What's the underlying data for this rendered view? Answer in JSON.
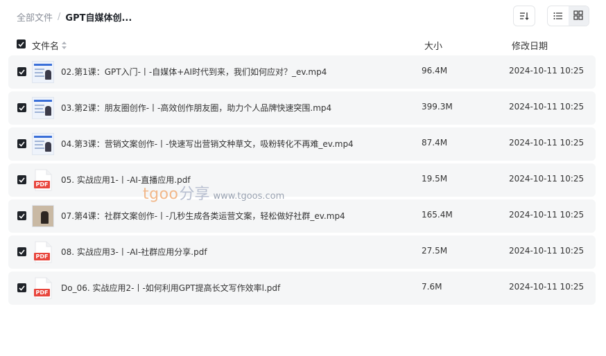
{
  "breadcrumb": {
    "root": "全部文件",
    "separator": "/",
    "current": "GPT自媒体创..."
  },
  "toolbar": {
    "sort_icon": "sort-icon",
    "list_view_icon": "list-view-icon",
    "grid_view_icon": "grid-view-icon",
    "active_view": "list"
  },
  "header": {
    "name": "文件名",
    "size": "大小",
    "date": "修改日期"
  },
  "files": [
    {
      "name": "02.第1课：GPT入门-丨-自媒体+AI时代到来，我们如何应对？_ev.mp4",
      "size": "96.4M",
      "date": "2024-10-11 10:25",
      "type": "video",
      "checked": true
    },
    {
      "name": "03.第2课：朋友圈创作-丨-高效创作朋友圈，助力个人品牌快速突围.mp4",
      "size": "399.3M",
      "date": "2024-10-11 10:25",
      "type": "video",
      "checked": true
    },
    {
      "name": "04.第3课：营销文案创作-丨-快速写出营销文种草文，吸粉转化不再难_ev.mp4",
      "size": "87.4M",
      "date": "2024-10-11 10:25",
      "type": "video",
      "checked": true
    },
    {
      "name": "05. 实战应用1-丨-AI-直播应用.pdf",
      "size": "19.5M",
      "date": "2024-10-11 10:25",
      "type": "pdf",
      "checked": true
    },
    {
      "name": "07.第4课：社群文案创作-丨-几秒生成各类运营文案，轻松做好社群_ev.mp4",
      "size": "165.4M",
      "date": "2024-10-11 10:25",
      "type": "video-dark",
      "checked": true
    },
    {
      "name": "08. 实战应用3-丨-AI-社群应用分享.pdf",
      "size": "27.5M",
      "date": "2024-10-11 10:25",
      "type": "pdf",
      "checked": true
    },
    {
      "name": "Do_06. 实战应用2-丨-如何利用GPT提高长文写作效率l.pdf",
      "size": "7.6M",
      "date": "2024-10-11 10:25",
      "type": "pdf",
      "checked": true
    }
  ],
  "pdf_label": "PDF",
  "watermark": {
    "brand": "tgoo",
    "share": "分享",
    "url": "www.tgoos.com"
  },
  "colors": {
    "row_bg": "#f5f6f7",
    "checkbox": "#1f2329",
    "pdf_red": "#e8453c",
    "watermark_orange": "#f2b88a"
  }
}
